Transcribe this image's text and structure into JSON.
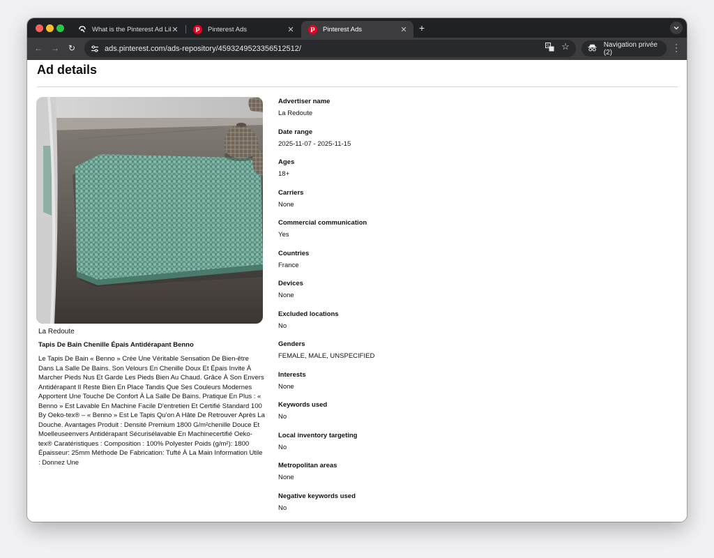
{
  "browser": {
    "tabs": [
      {
        "title": "What is the Pinterest Ad Library",
        "icon": "pinterest-help-icon",
        "active": false
      },
      {
        "title": "Pinterest Ads",
        "icon": "pinterest-logo-icon",
        "active": false
      },
      {
        "title": "Pinterest Ads",
        "icon": "pinterest-logo-icon",
        "active": true
      }
    ],
    "url": "ads.pinterest.com/ads-repository/4593249523356512512/",
    "private_label": "Navigation privée (2)"
  },
  "page": {
    "title": "Ad details",
    "ad": {
      "advertiser": "La Redoute",
      "title": "Tapis De Bain Chenille Épais Antidérapant Benno",
      "description": "Le Tapis De Bain « Benno » Crée Une Véritable Sensation De Bien-être Dans La Salle De Bains. Son Velours En Chenille Doux Et Épais Invite À Marcher Pieds Nus Et Garde Les Pieds Bien Au Chaud. Grâce À Son Envers Antidérapant Il Reste Bien En Place Tandis Que Ses Couleurs Modernes Apportent Une Touche De Confort À La Salle De Bains. Pratique En Plus : « Benno » Est Lavable En Machine Facile D'entretien Et Certifié Standard 100 By Oeko-tex® – « Benno » Est Le Tapis Qu'on A Hâte De Retrouver Après La Douche. Avantages Produit : Densité Premium 1800 G/m²chenille Douce Et Moelleuseenvers Antidérapant Sécuriséla­vable En Machinecertifié Oeko-tex® Caratéristiques : Composition : 100% Polyester Poids (g/m²): 1800 Épaisseur: 25mm Méthode De Fabrication: Tufté À La Main Information Utile : Donnez Une"
    },
    "details": [
      {
        "label": "Advertiser name",
        "value": "La Redoute"
      },
      {
        "label": "Date range",
        "value": "2025-11-07 - 2025-11-15"
      },
      {
        "label": "Ages",
        "value": "18+"
      },
      {
        "label": "Carriers",
        "value": "None"
      },
      {
        "label": "Commercial communication",
        "value": "Yes"
      },
      {
        "label": "Countries",
        "value": "France"
      },
      {
        "label": "Devices",
        "value": "None"
      },
      {
        "label": "Excluded locations",
        "value": "No"
      },
      {
        "label": "Genders",
        "value": "FEMALE, MALE, UNSPECIFIED"
      },
      {
        "label": "Interests",
        "value": "None"
      },
      {
        "label": "Keywords used",
        "value": "No"
      },
      {
        "label": "Local inventory targeting",
        "value": "No"
      },
      {
        "label": "Metropolitan areas",
        "value": "None"
      },
      {
        "label": "Negative keywords used",
        "value": "No"
      }
    ]
  },
  "colors": {
    "pinterest_red": "#e60023",
    "tab_bar": "#202124",
    "toolbar": "#3c3c3f",
    "rug": "#6fa597"
  }
}
